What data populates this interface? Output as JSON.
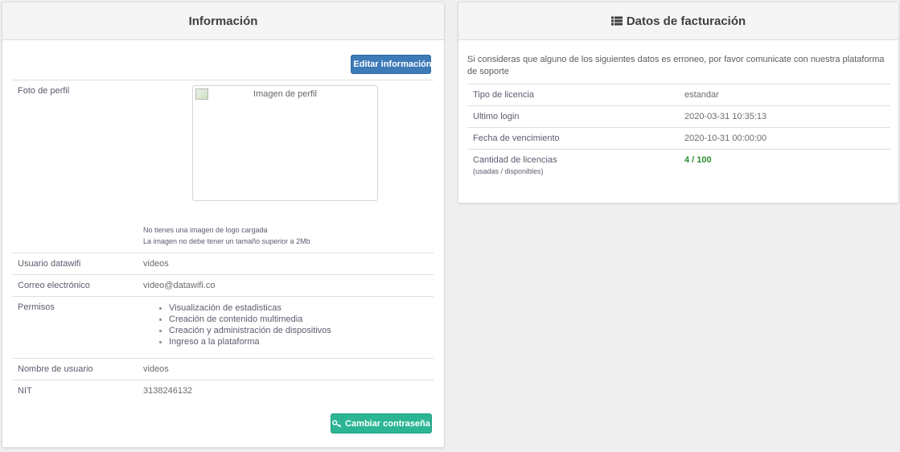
{
  "info": {
    "title": "Información",
    "edit_button": "Editar información",
    "profile": {
      "label": "Foto de perfil",
      "image_alt": "Imagen de perfil",
      "note_line1": "No tienes una imagen de logo cargada",
      "note_line2": "La imagen no debe tener un tamaño superior a 2Mb"
    },
    "rows": {
      "usuario": {
        "label": "Usuario datawifi",
        "value": "videos"
      },
      "correo": {
        "label": "Correo electrónico",
        "value": "video@datawifi.co"
      },
      "permisos": {
        "label": "Permisos",
        "items": [
          "Visualización de estadisticas",
          "Creación de contenido multimedia",
          "Creación y administración de dispositivos",
          "Ingreso a la plataforma"
        ]
      },
      "nombre": {
        "label": "Nombre de usuario",
        "value": "videos"
      },
      "nit": {
        "label": "NIT",
        "value": "3138246132"
      }
    },
    "password_button": "Cambiar contraseña"
  },
  "billing": {
    "title": "Datos de facturación",
    "intro": "Si consideras que alguno de los siguientes datos es erroneo, por favor comunicate con nuestra plataforma de soporte",
    "rows": {
      "tipo": {
        "label": "Tipo de licencia",
        "value": "estandar"
      },
      "login": {
        "label": "Ultimo login",
        "value": "2020-03-31 10:35:13"
      },
      "vencimiento": {
        "label": "Fecha de vencimiento",
        "value": "2020-10-31 00:00:00"
      },
      "cantidad": {
        "label": "Cantidad de licencias",
        "sublabel": "(usadas / disponibles)",
        "value": "4 / 100"
      }
    }
  },
  "colors": {
    "primary_button": "#3c7ab8",
    "success_button": "#2cb593",
    "license_value": "#2e8b2e"
  },
  "icons": {
    "edit": "pencil-icon",
    "key": "key-icon",
    "list": "list-icon"
  }
}
